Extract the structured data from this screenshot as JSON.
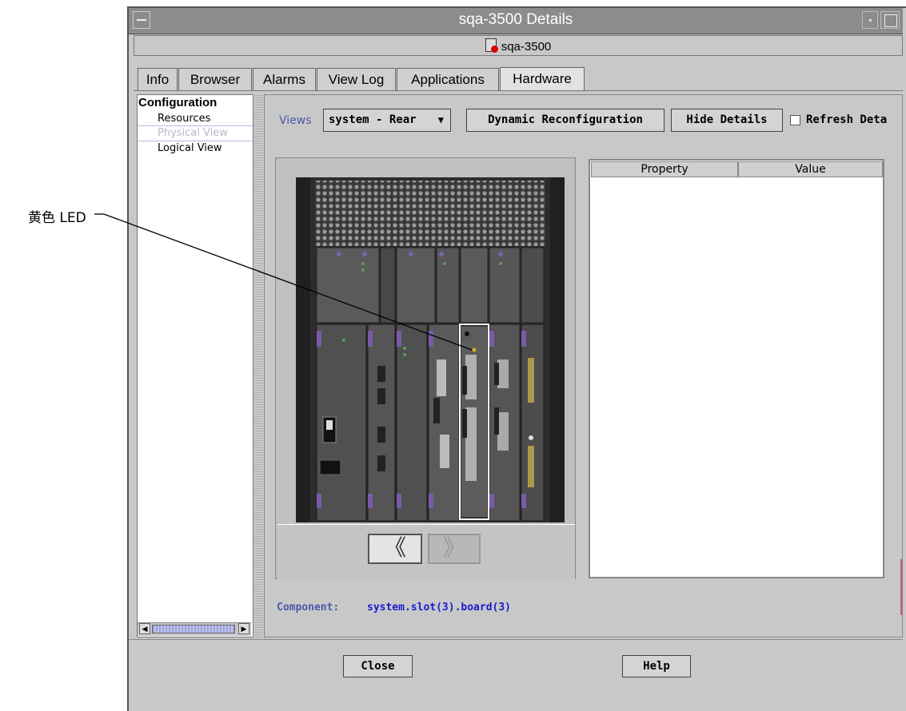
{
  "window": {
    "title": "sqa-3500 Details",
    "host": "sqa-3500"
  },
  "tabs": [
    {
      "label": "Info"
    },
    {
      "label": "Browser"
    },
    {
      "label": "Alarms"
    },
    {
      "label": "View Log"
    },
    {
      "label": "Applications"
    },
    {
      "label": "Hardware"
    }
  ],
  "active_tab": "Hardware",
  "tree": {
    "root": "Configuration",
    "items": [
      {
        "label": "Resources"
      },
      {
        "label": "Physical View"
      },
      {
        "label": "Logical View"
      }
    ]
  },
  "toolbar": {
    "views_label": "Views",
    "views_selected": "system - Rear",
    "dynamic_reconfig_label": "Dynamic Reconfiguration",
    "hide_details_label": "Hide Details",
    "refresh_label": "Refresh Deta"
  },
  "nav": {
    "prev": "《",
    "next": "》"
  },
  "property_table": {
    "columns": [
      "Property",
      "Value"
    ]
  },
  "component": {
    "label": "Component:",
    "value": "system.slot(3).board(3)"
  },
  "buttons": {
    "close": "Close",
    "help": "Help"
  },
  "callout": {
    "label": "黄色 LED"
  },
  "colors": {
    "accent_label": "#4a5aa8",
    "link_blue": "#1a1ad0",
    "selection_box": "#ffffff",
    "board_accent": "#7a5aa8"
  }
}
